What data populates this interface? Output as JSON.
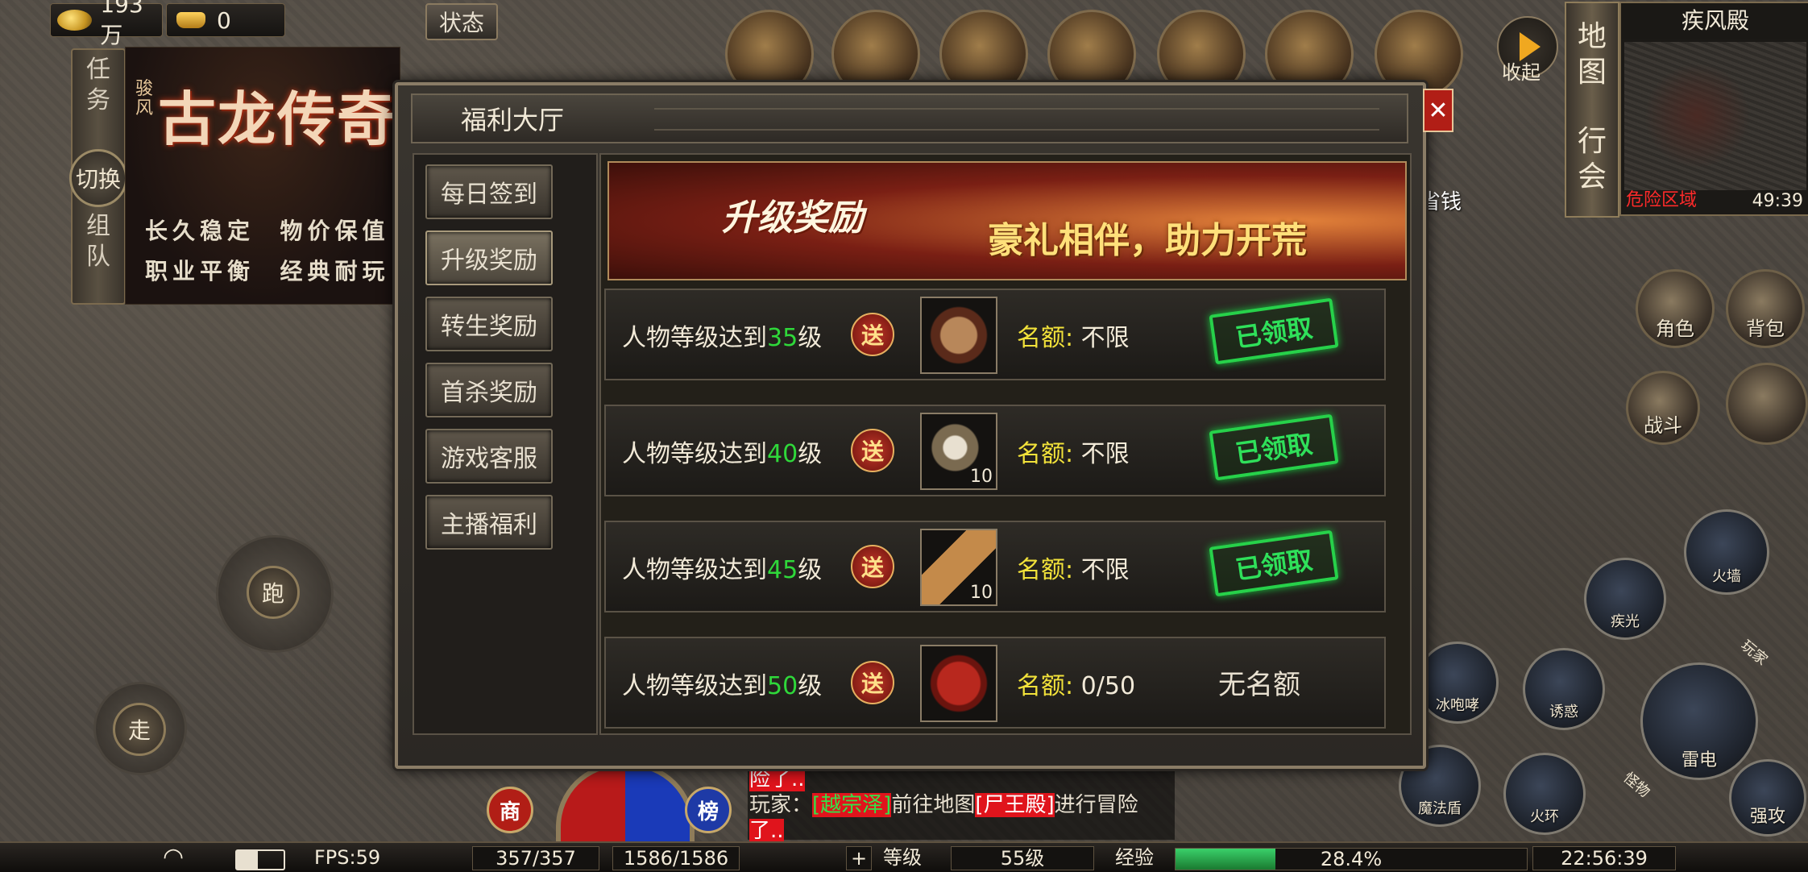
{
  "currency": {
    "gold": "193万",
    "ingot": "0",
    "status_label": "状态"
  },
  "side_tabs": {
    "task": "任务",
    "switch": "切换",
    "team": "组队"
  },
  "banner": {
    "logo": "古龙传奇",
    "prefix": "骏风",
    "slogan1": "长久稳定  物价保值",
    "slogan2": "职业平衡  经典耐玩"
  },
  "top_icons": [
    "scales-icon",
    "scroll-icon",
    "doll-icon",
    "dragon-boat-icon",
    "gift-box-icon",
    "treasure-lock-icon",
    "gold-ingot-icon"
  ],
  "collapse_label": "收起",
  "save_money_label": "省钱",
  "minimap": {
    "map_name": "疾风殿",
    "buttons": [
      "地图",
      "行会"
    ],
    "danger_text": "危险区域",
    "time": "49:39"
  },
  "dialog": {
    "title": "福利大厅",
    "nav": [
      "每日签到",
      "升级奖励",
      "转生奖励",
      "首杀奖励",
      "游戏客服",
      "主播福利"
    ],
    "active_nav": "升级奖励",
    "hero_title": "升级奖励",
    "hero_slogan": "豪礼相伴，助力开荒",
    "rewards": [
      {
        "req_prefix": "人物等级达到",
        "level": "35",
        "req_suffix": "级",
        "gift": "送",
        "item_icon": "round-medal-icon",
        "count": "",
        "quota_key": "名额:",
        "quota_val": "不限",
        "status": "已领取"
      },
      {
        "req_prefix": "人物等级达到",
        "level": "40",
        "req_suffix": "级",
        "gift": "送",
        "item_icon": "bundle-icon",
        "count": "10",
        "quota_key": "名额:",
        "quota_val": "不限",
        "status": "已领取"
      },
      {
        "req_prefix": "人物等级达到",
        "level": "45",
        "req_suffix": "级",
        "gift": "送",
        "item_icon": "scroll-item-icon",
        "count": "10",
        "quota_key": "名额:",
        "quota_val": "不限",
        "status": "已领取"
      },
      {
        "req_prefix": "人物等级达到",
        "level": "50",
        "req_suffix": "级",
        "gift": "送",
        "item_icon": "treasure-chest-icon",
        "count": "",
        "quota_key": "名额:",
        "quota_val": "0/50",
        "status": "无名额"
      }
    ]
  },
  "right_buttons": {
    "character": "角色",
    "bag": "背包",
    "battle": "战斗"
  },
  "skills": {
    "fire_wall": "火墙",
    "lightning": "疾光",
    "ice_roar": "冰咆哮",
    "charm": "诱惑",
    "thunder": "雷电",
    "magic_shield": "魔法盾",
    "fire_ring": "火环",
    "strong_attack": "强攻",
    "player": "玩家",
    "monster": "怪物"
  },
  "joystick": {
    "run": "跑",
    "walk": "走"
  },
  "chat": {
    "line1": "险了..",
    "line2_prefix": "玩家：",
    "line2_name": "[越宗泽]",
    "line2_mid": "前往地图",
    "line2_map": "[尸王殿]",
    "line2_suffix": "进行冒险",
    "line3": "了.."
  },
  "orb_buttons": {
    "shop": "商",
    "rank": "榜"
  },
  "bottom": {
    "fps": "FPS:59",
    "hp": "357/357",
    "mp": "1586/1586",
    "plus": "+",
    "level_label": "等级",
    "level": "55级",
    "exp_label": "经验",
    "exp": "28.4%",
    "exp_fraction": 0.284,
    "clock": "22:56:39"
  }
}
